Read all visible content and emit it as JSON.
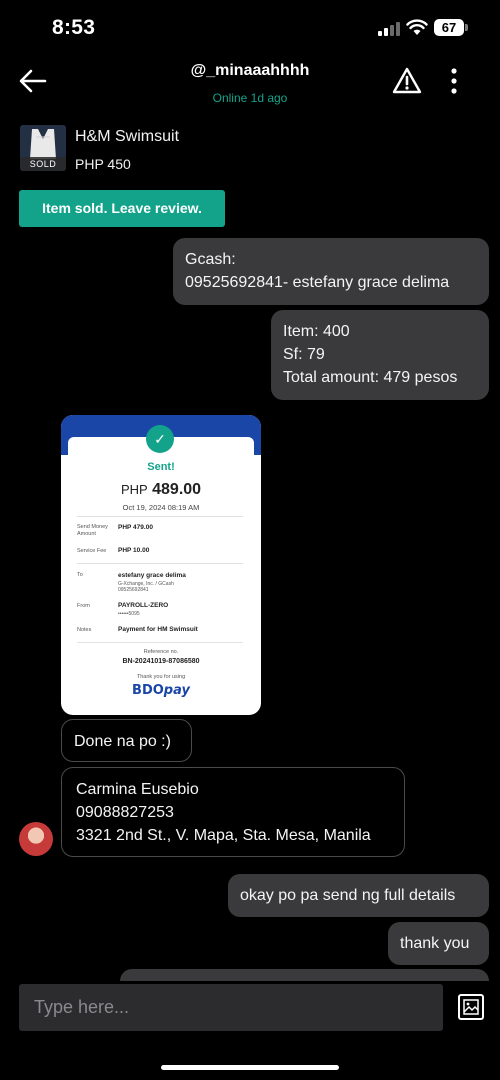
{
  "status_bar": {
    "time": "8:53",
    "battery": "67"
  },
  "header": {
    "username": "@_minaaahhhh",
    "online_status": "Online 1d ago"
  },
  "product": {
    "title": "H&M Swimsuit",
    "price": "PHP 450",
    "badge": "SOLD",
    "review_button": "Item sold. Leave review."
  },
  "messages": [
    {
      "direction": "out",
      "lines": [
        "Gcash:",
        "09525692841-  estefany grace delima"
      ]
    },
    {
      "direction": "out",
      "lines": [
        "Item: 400",
        "Sf: 79",
        "Total amount: 479 pesos"
      ]
    },
    {
      "direction": "in",
      "lines": [
        "Done na po :)"
      ]
    },
    {
      "direction": "in",
      "lines": [
        "Carmina Eusebio",
        "09088827253",
        "3321 2nd St., V. Mapa, Sta. Mesa, Manila"
      ]
    },
    {
      "direction": "out",
      "lines": [
        "okay po pa send ng full details"
      ]
    },
    {
      "direction": "out",
      "lines": [
        "thank you"
      ]
    }
  ],
  "receipt": {
    "status": "Sent!",
    "currency": "PHP",
    "amount": "489.00",
    "date": "Oct 19, 2024 08:19 AM",
    "send_money_label": "Send Money Amount",
    "send_money_value": "PHP 479.00",
    "service_fee_label": "Service Fee",
    "service_fee_value": "PHP 10.00",
    "to_label": "To",
    "to_name": "estefany grace delima",
    "to_sub1": "G-Xchange, Inc. / GCash",
    "to_sub2": "09525692841",
    "from_label": "From",
    "from_name": "PAYROLL-ZERO",
    "from_sub": "••••••5095",
    "notes_label": "Notes",
    "notes_value": "Payment for HM Swimsuit",
    "reference_label": "Reference no.",
    "reference_value": "BN-20241019-87086580",
    "thanks": "Thank you for using",
    "brand_bdo": "BDO",
    "brand_pay": "pay"
  },
  "composer": {
    "placeholder": "Type here..."
  },
  "colors": {
    "accent": "#13a38b",
    "outgoing_bubble": "#3a3a3c",
    "background": "#000000",
    "bdo_blue": "#1a46a8"
  }
}
